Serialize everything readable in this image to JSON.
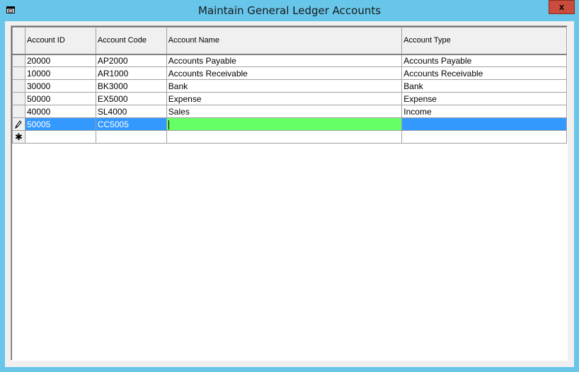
{
  "window": {
    "title": "Maintain General Ledger Accounts",
    "close_label": "x"
  },
  "colors": {
    "titlebar": "#67c6ea",
    "selection": "#3399ff",
    "editing_cell": "#66ff66",
    "close_button": "#c94c3c"
  },
  "grid": {
    "columns": [
      "Account ID",
      "Account Code",
      "Account Name",
      "Account Type"
    ],
    "rows": [
      {
        "id": "20000",
        "code": "AP2000",
        "name": "Accounts Payable",
        "type": "Accounts Payable"
      },
      {
        "id": "10000",
        "code": "AR1000",
        "name": "Accounts Receivable",
        "type": "Accounts Receivable"
      },
      {
        "id": "30000",
        "code": "BK3000",
        "name": "Bank",
        "type": "Bank"
      },
      {
        "id": "50000",
        "code": "EX5000",
        "name": "Expense",
        "type": "Expense"
      },
      {
        "id": "40000",
        "code": "SL4000",
        "name": "Sales",
        "type": "Income"
      }
    ],
    "editing_row": {
      "id": "50005",
      "code": "CC5005",
      "name": "",
      "type": ""
    },
    "editing_indicator": "pencil-icon",
    "new_row_indicator": "asterisk-icon",
    "new_row_glyph": "✱"
  }
}
